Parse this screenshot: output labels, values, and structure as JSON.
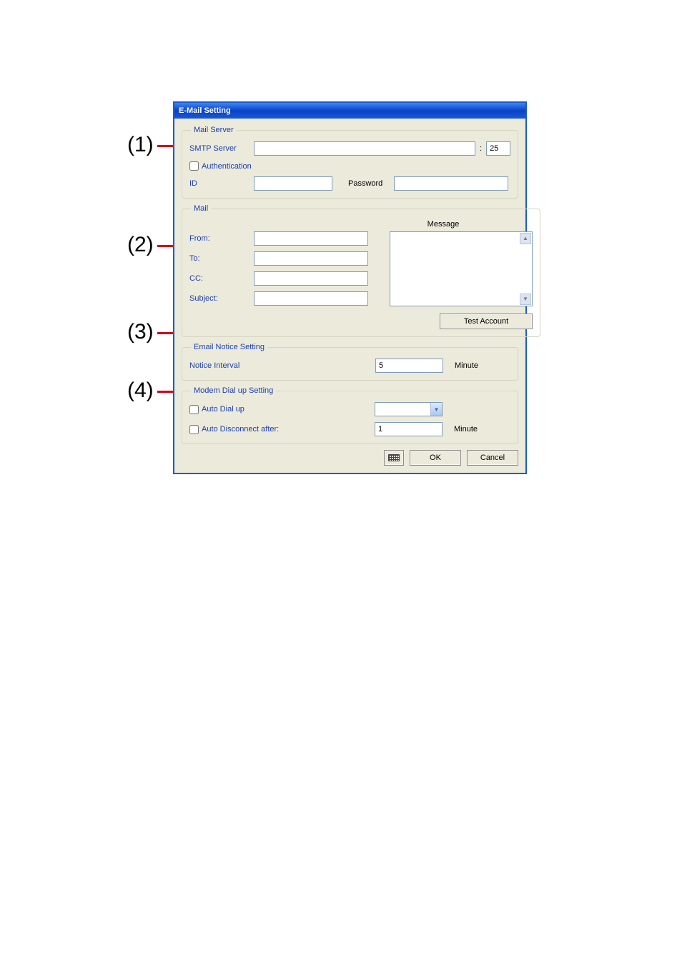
{
  "callouts": {
    "c1": "(1)",
    "c2": "(2)",
    "c3": "(3)",
    "c4": "(4)"
  },
  "dialog": {
    "title": "E-Mail Setting",
    "mailServer": {
      "legend": "Mail Server",
      "smtpLabel": "SMTP Server",
      "smtpValue": "",
      "colon": ":",
      "portValue": "25",
      "authLabel": "Authentication",
      "authChecked": false,
      "idLabel": "ID",
      "idValue": "",
      "passwordLabel": "Password",
      "passwordValue": ""
    },
    "mail": {
      "legend": "Mail",
      "messageLabel": "Message",
      "fromLabel": "From:",
      "fromValue": "",
      "toLabel": "To:",
      "toValue": "",
      "ccLabel": "CC:",
      "ccValue": "",
      "subjectLabel": "Subject:",
      "subjectValue": "",
      "messageValue": "",
      "testAccount": "Test Account"
    },
    "notice": {
      "legend": "Email Notice Setting",
      "intervalLabel": "Notice Interval",
      "intervalValue": "5",
      "intervalUnit": "Minute"
    },
    "modem": {
      "legend": "Modem Dial up Setting",
      "autoDialLabel": "Auto Dial up",
      "autoDialChecked": false,
      "autoDialSelected": "",
      "autoDiscLabel": "Auto Disconnect after:",
      "autoDiscChecked": false,
      "autoDiscValue": "1",
      "autoDiscUnit": "Minute"
    },
    "buttons": {
      "keyboard": "keyboard-icon",
      "ok": "OK",
      "cancel": "Cancel"
    }
  }
}
